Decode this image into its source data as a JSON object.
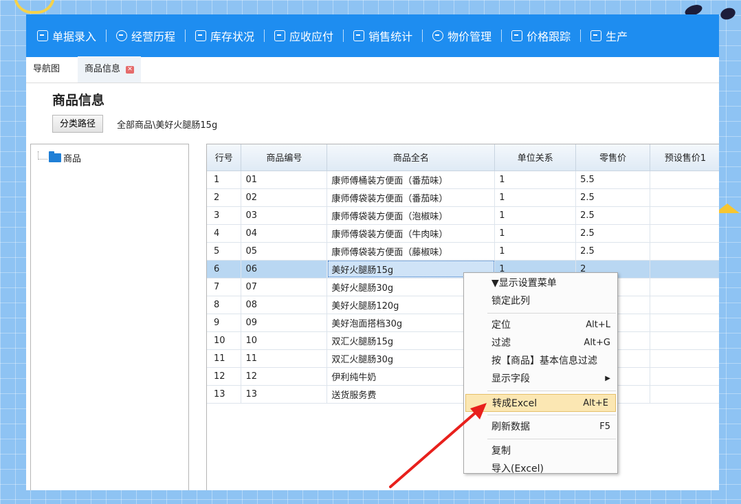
{
  "topnav": {
    "items": [
      {
        "label": "单据录入",
        "icon": "edit-icon"
      },
      {
        "label": "经营历程",
        "icon": "check-circle-icon"
      },
      {
        "label": "库存状况",
        "icon": "calendar-icon"
      },
      {
        "label": "应收应付",
        "icon": "receipt-icon"
      },
      {
        "label": "销售统计",
        "icon": "chart-icon"
      },
      {
        "label": "物价管理",
        "icon": "yen-icon"
      },
      {
        "label": "价格跟踪",
        "icon": "track-icon"
      },
      {
        "label": "生产",
        "icon": "document-icon"
      }
    ]
  },
  "tabs": {
    "nav": "导航图",
    "product": "商品信息"
  },
  "page": {
    "title": "商品信息",
    "category_button": "分类路径",
    "path": "全部商品\\美好火腿肠15g"
  },
  "tree": {
    "root": "商品"
  },
  "grid": {
    "columns": [
      "行号",
      "商品编号",
      "商品全名",
      "单位关系",
      "零售价",
      "预设售价1"
    ],
    "rows": [
      [
        "1",
        "01",
        "康师傅桶装方便面（番茄味）",
        "1",
        "5.5",
        ""
      ],
      [
        "2",
        "02",
        "康师傅袋装方便面（番茄味）",
        "1",
        "2.5",
        ""
      ],
      [
        "3",
        "03",
        "康师傅袋装方便面（泡椒味）",
        "1",
        "2.5",
        ""
      ],
      [
        "4",
        "04",
        "康师傅袋装方便面（牛肉味）",
        "1",
        "2.5",
        ""
      ],
      [
        "5",
        "05",
        "康师傅袋装方便面（藤椒味）",
        "1",
        "2.5",
        ""
      ],
      [
        "6",
        "06",
        "美好火腿肠15g",
        "1",
        "2",
        ""
      ],
      [
        "7",
        "07",
        "美好火腿肠30g",
        "",
        "",
        ""
      ],
      [
        "8",
        "08",
        "美好火腿肠120g",
        "",
        "",
        ""
      ],
      [
        "9",
        "09",
        "美好泡面搭档30g",
        "",
        "",
        ""
      ],
      [
        "10",
        "10",
        "双汇火腿肠15g",
        "",
        "",
        ""
      ],
      [
        "11",
        "11",
        "双汇火腿肠30g",
        "",
        "",
        ""
      ],
      [
        "12",
        "12",
        "伊利纯牛奶",
        "",
        "",
        ""
      ],
      [
        "13",
        "13",
        "送货服务费",
        "",
        "",
        ""
      ]
    ],
    "selected_row": 6
  },
  "context_menu": {
    "show_settings": "▼显示设置菜单",
    "lock_column": "锁定此列",
    "locate": "定位",
    "locate_sc": "Alt+L",
    "filter": "过滤",
    "filter_sc": "Alt+G",
    "filter_basic": "按【商品】基本信息过滤",
    "show_fields": "显示字段",
    "to_excel": "转成Excel",
    "to_excel_sc": "Alt+E",
    "refresh": "刷新数据",
    "refresh_sc": "F5",
    "copy": "复制",
    "import": "导入(Excel)"
  },
  "colors": {
    "nav_bg": "#1e8df0",
    "highlight": "#fbe7b3",
    "selected_row": "#b9d7f2",
    "arrow": "#e8201c"
  }
}
